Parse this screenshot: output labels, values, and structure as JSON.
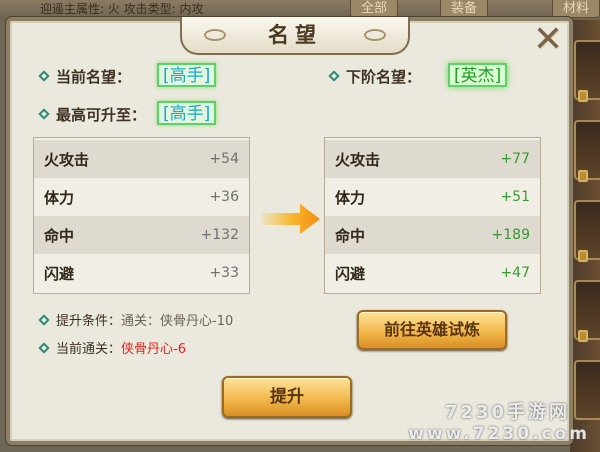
{
  "background": {
    "top_text": "迎遥主属性: 火 攻击类型: 内攻",
    "tabs": [
      "全部",
      "装备",
      "材料"
    ]
  },
  "dialog": {
    "title": "名望",
    "close_glyph": "✕"
  },
  "current": {
    "label": "当前名望：",
    "rank": "[高手]"
  },
  "next": {
    "label": "下阶名望：",
    "rank": "[英杰]"
  },
  "max": {
    "label": "最高可升至：",
    "rank": "[高手]"
  },
  "current_stats": [
    {
      "name": "火攻击",
      "value": "+54"
    },
    {
      "name": "体力",
      "value": "+36"
    },
    {
      "name": "命中",
      "value": "+132"
    },
    {
      "name": "闪避",
      "value": "+33"
    }
  ],
  "next_stats": [
    {
      "name": "火攻击",
      "value": "+77"
    },
    {
      "name": "体力",
      "value": "+51"
    },
    {
      "name": "命中",
      "value": "+189"
    },
    {
      "name": "闪避",
      "value": "+47"
    }
  ],
  "condition": {
    "label": "提升条件：",
    "value": "通关：侠骨丹心-10"
  },
  "current_clear": {
    "label": "当前通关：",
    "value": "侠骨丹心-6"
  },
  "buttons": {
    "trial": "前往英雄试炼",
    "upgrade": "提升"
  },
  "watermark": {
    "line1": "7230手游网",
    "line2": "www.7230.com"
  },
  "colors": {
    "accent_green": "#3a9a32",
    "warning_red": "#e0241c",
    "rank_cyan": "#1aa7c7",
    "button_gold": "#f2b94c"
  }
}
